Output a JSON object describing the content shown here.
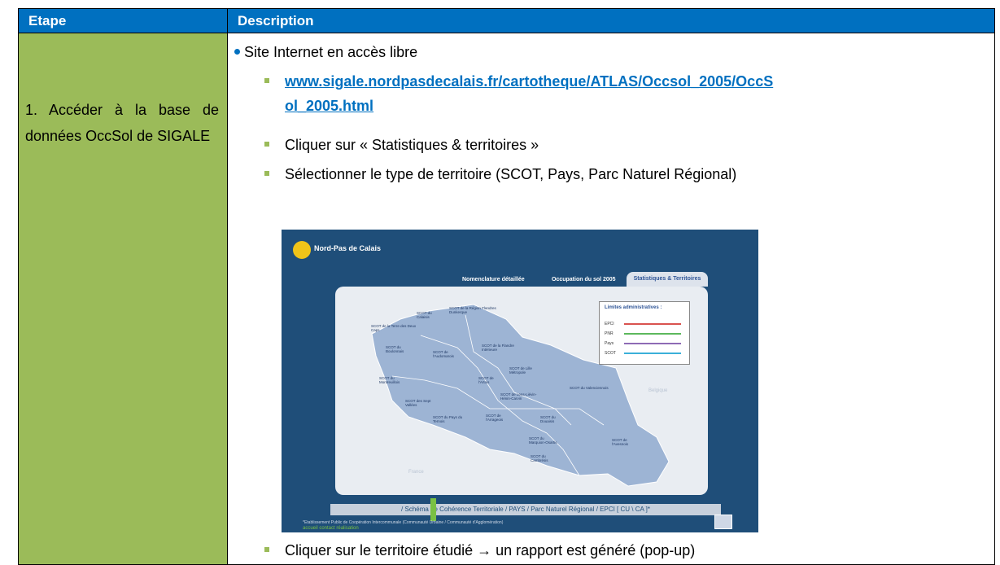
{
  "table": {
    "header_step": "Etape",
    "header_description": "Description",
    "step_text": "1. Accéder à la base de données OccSol de SIGALE",
    "bullet_main": "Site Internet en accès libre",
    "link": "www.sigale.nordpasdecalais.fr/cartotheque/ATLAS/Occsol_2005/OccSol_2005.html",
    "link_line1": "www.sigale.nordpasdecalais.fr/cartotheque/ATLAS/Occsol_2005/OccS",
    "link_line2": "ol_2005.html",
    "sub2": "Cliquer sur « Statistiques & territoires »",
    "sub3": "Sélectionner le type de territoire (SCOT, Pays, Parc Naturel Régional)",
    "sub4": "Cliquer sur le territoire étudié → un rapport est généré (pop-up)"
  },
  "screenshot": {
    "logo_text": "Nord-Pas de Calais",
    "tabs": [
      "Nomenclature détaillée",
      "Occupation du sol 2005"
    ],
    "active_tab": "Statistiques & Territoires",
    "legend_title": "Limites administratives :",
    "legend_rows": [
      "EPCI",
      "PNR",
      "Pays",
      "SCOT"
    ],
    "bottom_nav": "/ Schéma de Cohérence Territoriale  /  PAYS  /   Parc Naturel Régional   /   EPCI [ CU \\ CA ]*",
    "footnote": "*Etablissement Public de Coopération Intercommunale (Communauté Urbaine / Communauté d'Agglomération)",
    "footer_links": "accueil   contact   réalisation",
    "map_labels": [
      "SCOT de la Région Flandres Dunkerque",
      "SCOT du Calaisis",
      "SCOT de la Terre des Deux Caps",
      "SCOT du Boulonnais",
      "SCOT de l'Audomarois",
      "SCOT de la Flandre Intérieure",
      "SCOT de Lille Métropole",
      "SCOT du Montreuillois",
      "SCOT de l'Artois",
      "SCOT des Sept Vallées",
      "SCOT de Lens-Liévin-Hénin-Carvin",
      "SCOT du Pays du Ternois",
      "SCOT de l'Arrageois",
      "SCOT du Douaisis",
      "SCOT du Valenciennois",
      "SCOT du Marquion-Osartis",
      "SCOT du Cambrésis",
      "SCOT de l'Avesnois"
    ],
    "belgique": "Belgique",
    "france": "France",
    "colors": {
      "bg": "#1f4e79",
      "map": "#9db4d4",
      "accent": "#7ac143"
    }
  }
}
